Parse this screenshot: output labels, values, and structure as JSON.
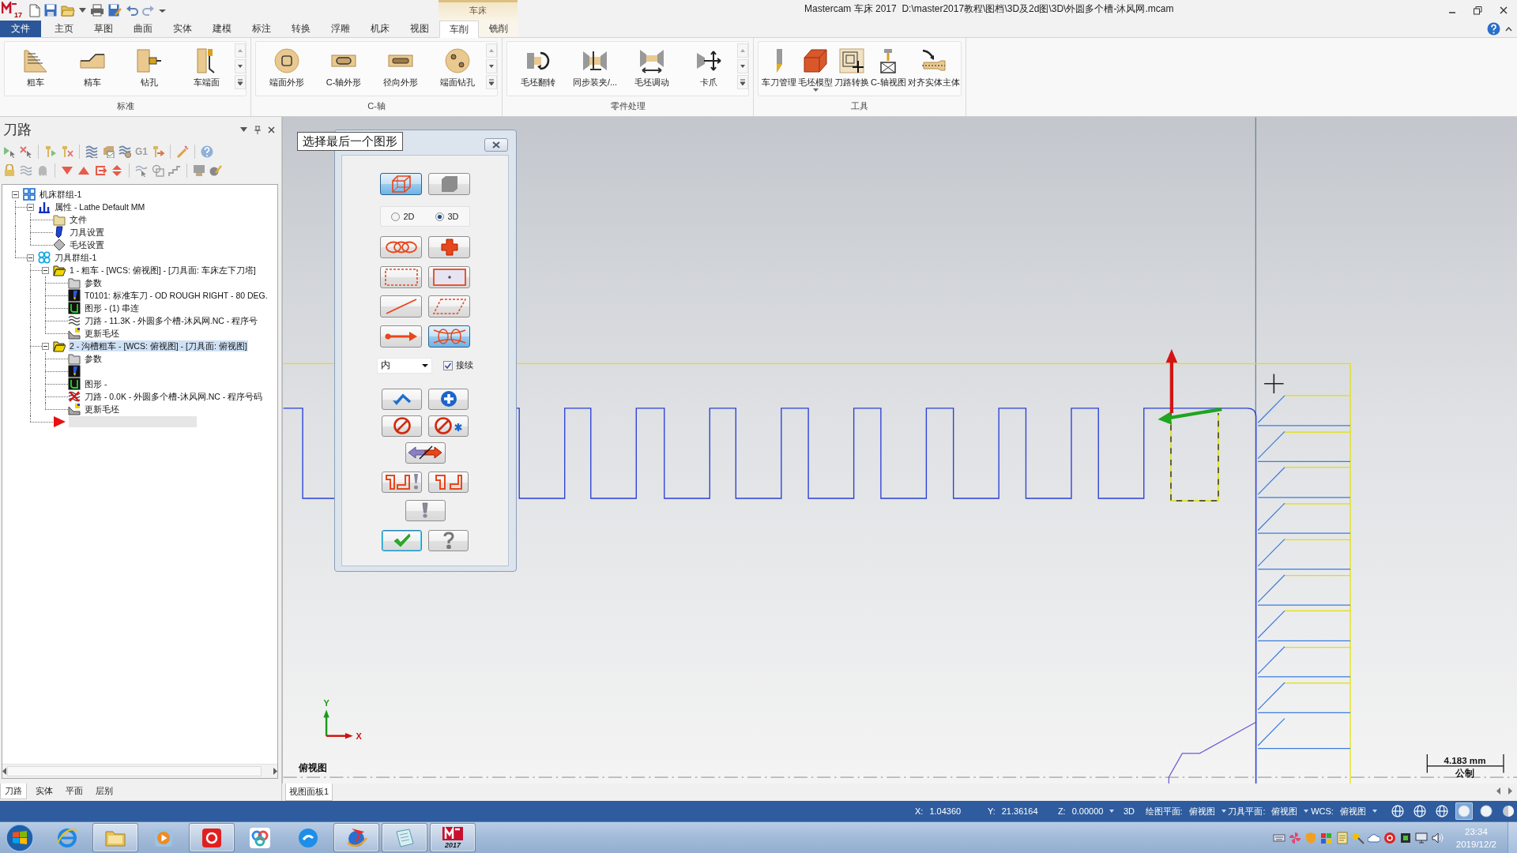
{
  "window": {
    "logo_text": "17",
    "context_group": "车床",
    "title": "Mastercam 车床 2017  D:\\master2017教程\\图档\\3D及2d图\\3D\\外圆多个槽-沐风网.mcam"
  },
  "ribbon": {
    "tabs": [
      {
        "label": "文件",
        "kind": "file",
        "selected": false
      },
      {
        "label": "主页",
        "kind": "normal",
        "selected": false
      },
      {
        "label": "草图",
        "kind": "normal",
        "selected": false
      },
      {
        "label": "曲面",
        "kind": "normal",
        "selected": false
      },
      {
        "label": "实体",
        "kind": "normal",
        "selected": false
      },
      {
        "label": "建模",
        "kind": "normal",
        "selected": false
      },
      {
        "label": "标注",
        "kind": "normal",
        "selected": false
      },
      {
        "label": "转换",
        "kind": "normal",
        "selected": false
      },
      {
        "label": "浮雕",
        "kind": "normal",
        "selected": false
      },
      {
        "label": "机床",
        "kind": "normal",
        "selected": false
      },
      {
        "label": "视图",
        "kind": "normal",
        "selected": false
      },
      {
        "label": "车削",
        "kind": "context",
        "selected": true
      },
      {
        "label": "铣削",
        "kind": "context",
        "selected": false
      }
    ],
    "groups": [
      {
        "label": "标准",
        "scroll": true,
        "buttons": [
          {
            "label": "粗车",
            "kind": "rough"
          },
          {
            "label": "精车",
            "kind": "finish"
          },
          {
            "label": "钻孔",
            "kind": "drill"
          },
          {
            "label": "车端面",
            "kind": "face"
          }
        ]
      },
      {
        "label": "C-轴",
        "scroll": true,
        "buttons": [
          {
            "label": "端面外形",
            "kind": "facecontour"
          },
          {
            "label": "C-轴外形",
            "kind": "caxiscontour"
          },
          {
            "label": "径向外形",
            "kind": "radialcontour"
          },
          {
            "label": "端面钻孔",
            "kind": "facedrill"
          }
        ]
      },
      {
        "label": "零件处理",
        "scroll": true,
        "buttons": [
          {
            "label": "毛坯翻转",
            "kind": "flip"
          },
          {
            "label": "同步装夹/...",
            "kind": "transfer"
          },
          {
            "label": "毛坯调动",
            "kind": "advance"
          },
          {
            "label": "卡爪",
            "kind": "jaw"
          }
        ]
      },
      {
        "label": "工具",
        "scroll": false,
        "buttons": [
          {
            "label": "车刀管理",
            "kind": "tools"
          },
          {
            "label": "毛坯模型",
            "kind": "stockmodel",
            "dropdown": true
          },
          {
            "label": "刀路转换",
            "kind": "transform"
          },
          {
            "label": "C-轴视图",
            "kind": "caxisview"
          },
          {
            "label": "对齐实体主体",
            "kind": "align"
          }
        ]
      }
    ]
  },
  "toolpaths_panel": {
    "title": "刀路",
    "toolbar_label": "G1",
    "tree": [
      {
        "kind": "machinegroup",
        "label": "机床群组-1",
        "expanded": true,
        "selected": false,
        "children": [
          {
            "kind": "properties",
            "label": "属性 - Lathe Default MM",
            "expanded": true,
            "selected": false,
            "children": [
              {
                "kind": "files",
                "label": "文件",
                "selected": false
              },
              {
                "kind": "toolsettings",
                "label": "刀具设置",
                "selected": false
              },
              {
                "kind": "stocksettings",
                "label": "毛坯设置",
                "selected": false
              }
            ]
          },
          {
            "kind": "toolgroup",
            "label": "刀具群组-1",
            "expanded": true,
            "selected": false,
            "children": [
              {
                "kind": "operation",
                "label": "1 - 粗车 - [WCS: 俯视图] - [刀具面: 车床左下刀塔]",
                "expanded": true,
                "selected": false,
                "children": [
                  {
                    "kind": "parameters",
                    "label": "参数",
                    "selected": false
                  },
                  {
                    "kind": "tool",
                    "label": "T0101: 标准车刀 - OD ROUGH RIGHT - 80 DEG.",
                    "selected": false
                  },
                  {
                    "kind": "geometry",
                    "label": "图形 - (1) 串连",
                    "selected": false
                  },
                  {
                    "kind": "toolpath",
                    "label": "刀路 - 11.3K - 外圆多个槽-沐风网.NC - 程序号",
                    "dirty": false,
                    "selected": false
                  },
                  {
                    "kind": "stockupdate",
                    "label": "更新毛坯",
                    "selected": false
                  }
                ]
              },
              {
                "kind": "operation",
                "label": "2 - 沟槽粗车 - [WCS: 俯视图] - [刀具面: 俯视图]",
                "expanded": true,
                "selected": true,
                "children": [
                  {
                    "kind": "parameters",
                    "label": "参数",
                    "selected": false
                  },
                  {
                    "kind": "tool",
                    "selected": false
                  },
                  {
                    "kind": "geometry",
                    "label": "图形 -",
                    "selected": false
                  },
                  {
                    "kind": "toolpath",
                    "label": "刀路 - 0.0K - 外圆多个槽-沐风网.NC - 程序号码",
                    "dirty": true,
                    "selected": false
                  },
                  {
                    "kind": "stockupdate",
                    "label": "更新毛坯",
                    "selected": false
                  }
                ]
              },
              {
                "kind": "insert",
                "selected": false
              }
            ]
          }
        ]
      }
    ],
    "tabs": [
      {
        "label": "刀路",
        "selected": true
      },
      {
        "label": "实体",
        "selected": false
      },
      {
        "label": "平面",
        "selected": false
      },
      {
        "label": "层别",
        "selected": false
      }
    ]
  },
  "viewport": {
    "view_label": "俯视图",
    "gnomon": {
      "x": "X",
      "y": "Y"
    },
    "scale": {
      "value": "4.183 mm",
      "unit": "公制"
    },
    "tabs": [
      {
        "label": "视图面板1",
        "selected": true
      }
    ]
  },
  "chain_dialog": {
    "title": "选择最后一个图形",
    "mode_buttons": [
      {
        "kind": "wireframe",
        "selected": true
      },
      {
        "kind": "solid",
        "selected": false
      }
    ],
    "dimension": [
      {
        "label": "2D",
        "selected": false
      },
      {
        "label": "3D",
        "selected": true
      }
    ],
    "method_buttons": [
      {
        "kind": "chain",
        "selected": false
      },
      {
        "kind": "point",
        "selected": false
      },
      {
        "kind": "window",
        "selected": false
      },
      {
        "kind": "area",
        "selected": false
      },
      {
        "kind": "single",
        "selected": false
      },
      {
        "kind": "polygon",
        "selected": false
      },
      {
        "kind": "vector",
        "selected": false
      },
      {
        "kind": "partial",
        "selected": true
      }
    ],
    "filter": {
      "value": "内"
    },
    "wait": {
      "label": "接续",
      "checked": true
    },
    "action_rows": [
      [
        {
          "kind": "back"
        },
        {
          "kind": "add"
        }
      ],
      [
        {
          "kind": "stop"
        },
        {
          "kind": "stopall"
        }
      ],
      [
        {
          "kind": "reverse"
        }
      ],
      [
        {
          "kind": "optionswarn"
        },
        {
          "kind": "options"
        }
      ],
      [
        {
          "kind": "warn"
        }
      ],
      [
        {
          "kind": "ok"
        },
        {
          "kind": "help"
        }
      ]
    ]
  },
  "status_bar": {
    "fields": [
      {
        "label": "X:",
        "value": "1.04360"
      },
      {
        "label": "Y:",
        "value": "21.36164"
      },
      {
        "label": "Z:",
        "value": "0.00000",
        "dropdown": true
      },
      {
        "label": "3D"
      },
      {
        "label": "绘图平面:",
        "value": "俯视图",
        "dropdown": true
      },
      {
        "label": "刀具平面:",
        "value": "俯视图",
        "dropdown": true
      },
      {
        "label": "WCS:",
        "value": "俯视图",
        "dropdown": true
      }
    ],
    "view_buttons": [
      {
        "kind": "globe",
        "selected": false
      },
      {
        "kind": "globe",
        "selected": false
      },
      {
        "kind": "globe",
        "selected": false
      },
      {
        "kind": "sphere",
        "selected": true
      },
      {
        "kind": "sphere",
        "selected": false
      },
      {
        "kind": "halfsphere",
        "selected": false
      }
    ]
  },
  "taskbar": {
    "apps": [
      {
        "kind": "browser",
        "running": false
      },
      {
        "kind": "folder",
        "running": true
      },
      {
        "kind": "player",
        "running": false
      },
      {
        "kind": "music",
        "running": true
      },
      {
        "kind": "cloud",
        "running": false
      },
      {
        "kind": "chat",
        "running": false
      },
      {
        "kind": "globe",
        "running": true
      },
      {
        "kind": "notepad",
        "running": true
      },
      {
        "kind": "mastercam",
        "label": "2017",
        "running": true
      }
    ],
    "clock": {
      "time": "23:34",
      "date": "2019/12/2"
    }
  }
}
